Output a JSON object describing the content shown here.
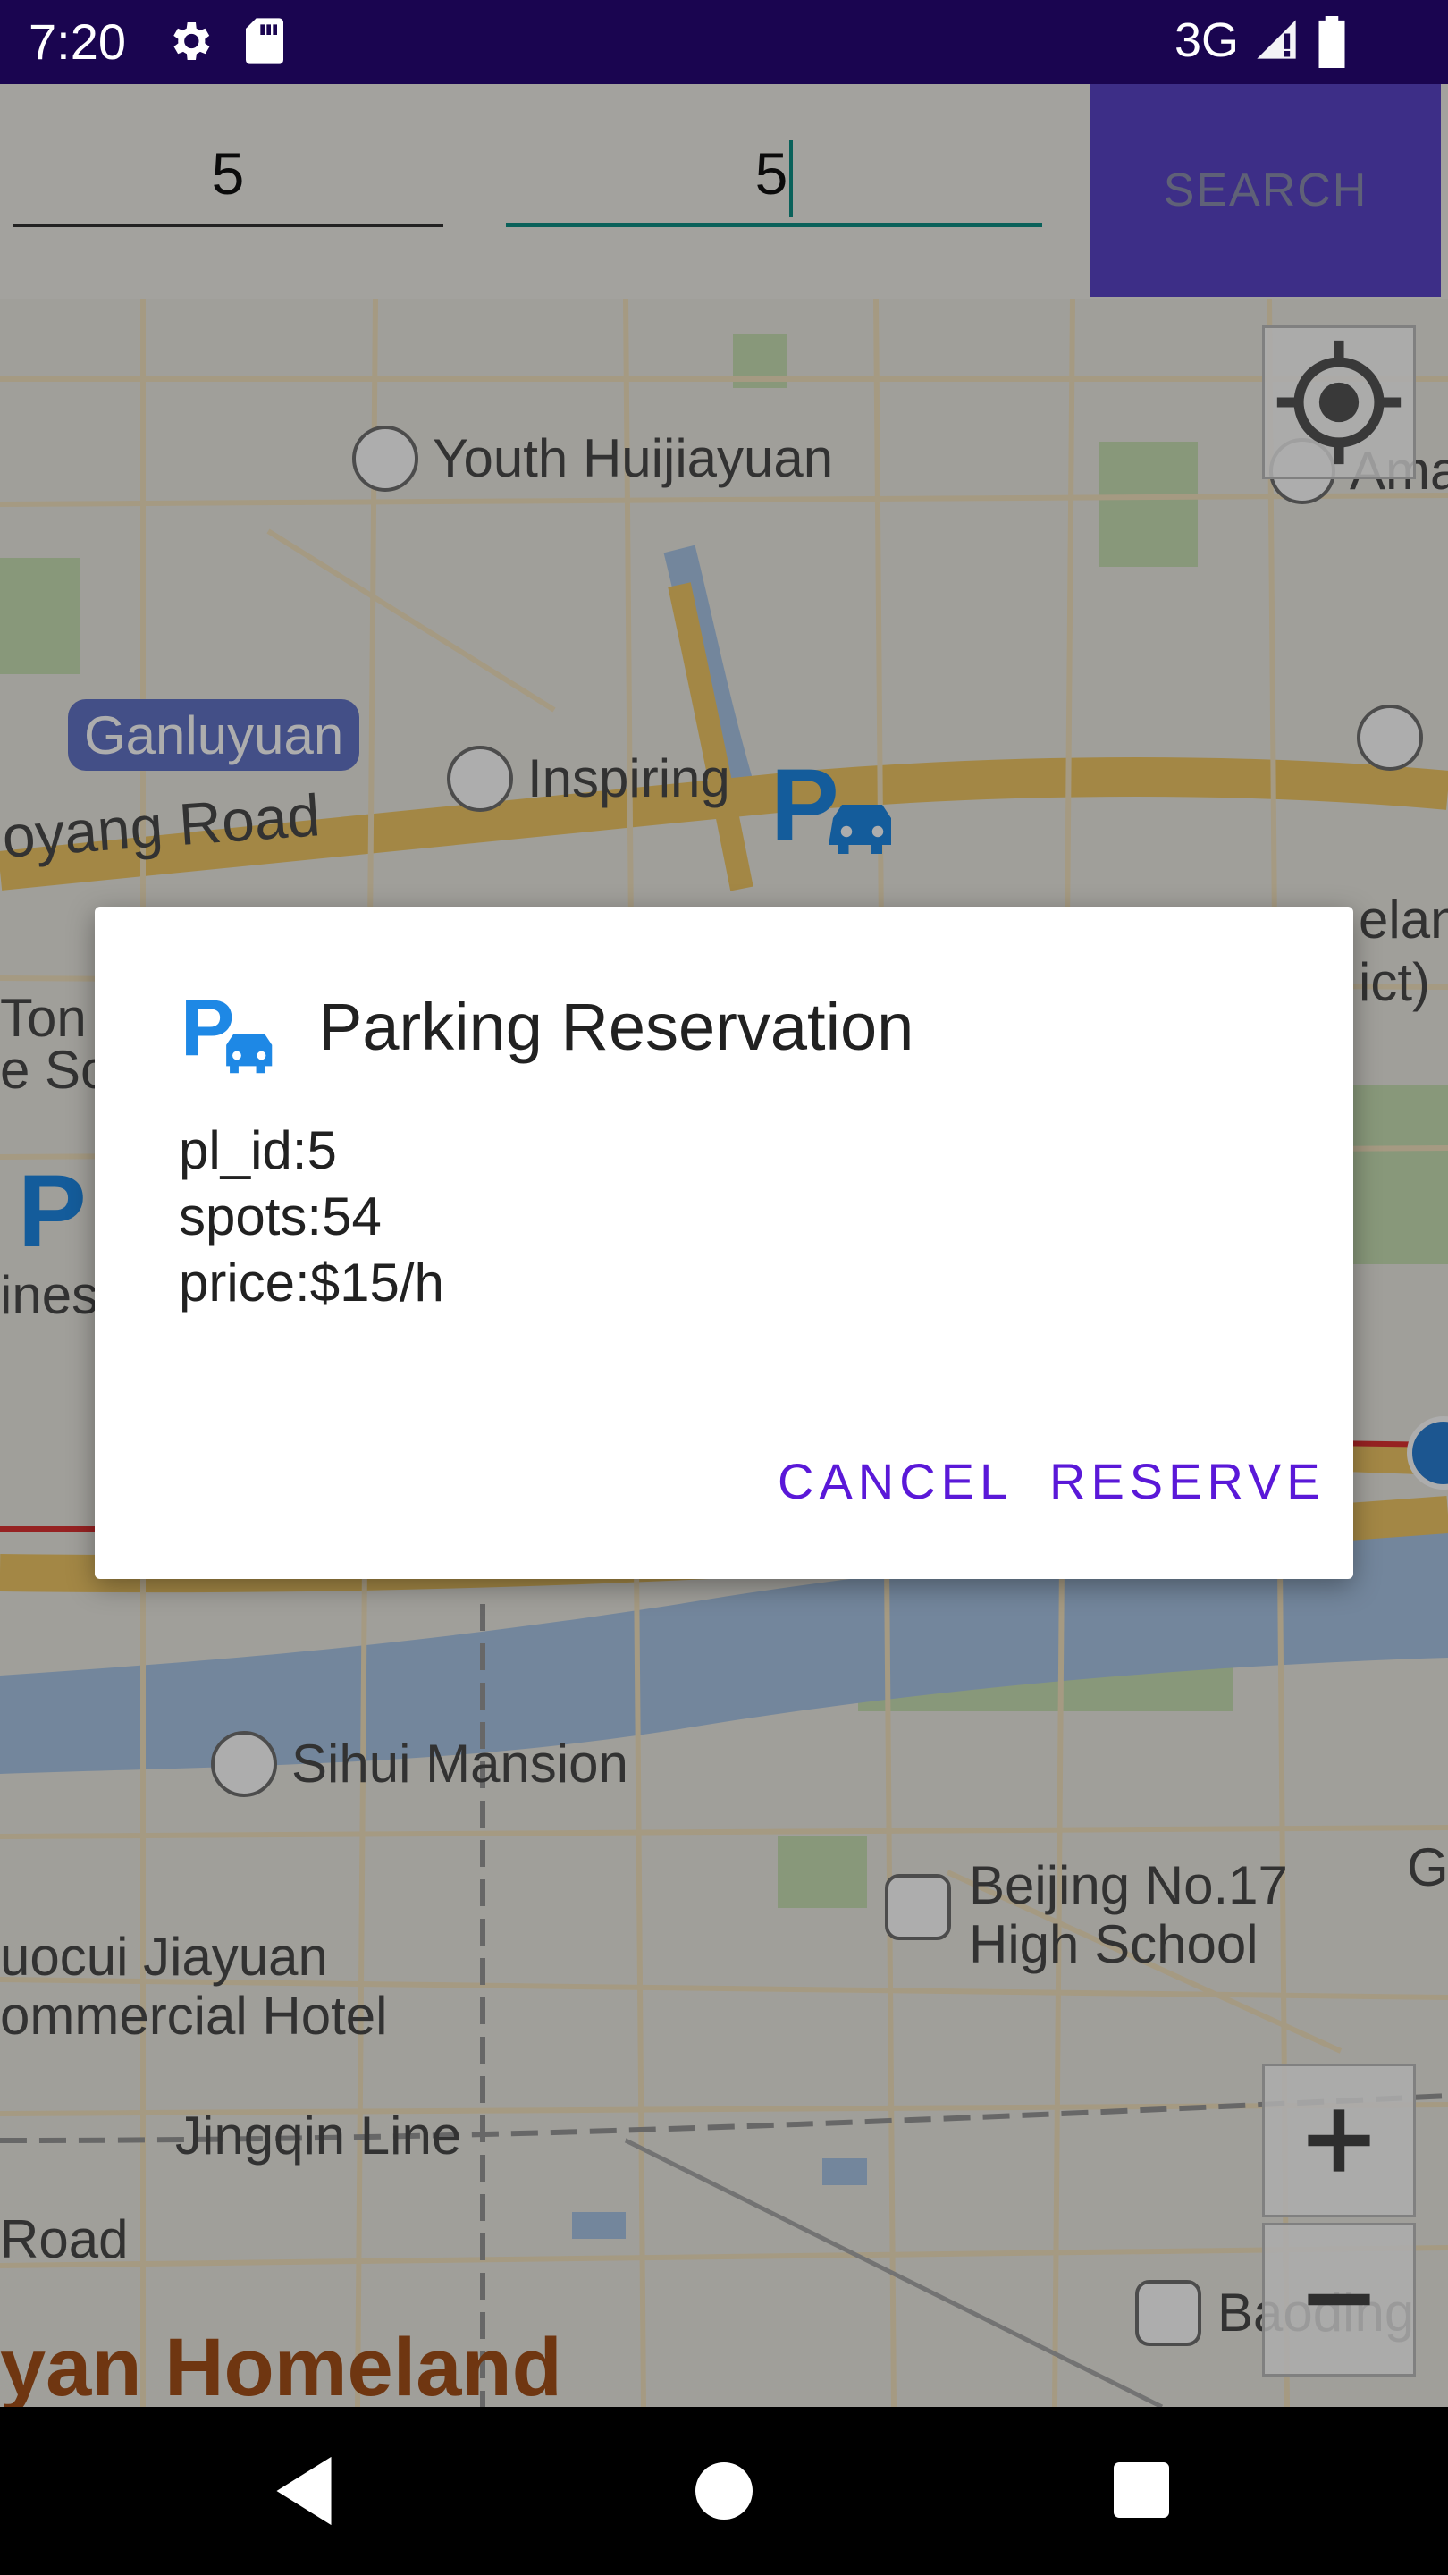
{
  "status_bar": {
    "time": "7:20",
    "network": "3G"
  },
  "search": {
    "field1_value": "5",
    "field2_value": "5",
    "button_label": "SEARCH"
  },
  "map_labels": {
    "youth": "Youth Huijiayuan",
    "ganluyuan": "Ganluyuan",
    "inspiring": "Inspiring",
    "road": "oyang Road",
    "tong": "Ton",
    "sc": "e Sc",
    "sihui": "Sihui Mansion",
    "beijing1": "Beijing No.17",
    "beijing2": "High School",
    "uocui": "uocui Jiayuan",
    "commercial": "ommercial Hotel",
    "jingqin": "Jingqin Line",
    "road2": "Road",
    "homeland": "yan Homeland",
    "baoding": "Baoding",
    "ama": "Ama",
    "elan": "elanc",
    "ict": "ict)",
    "g": "G",
    "ies": "ines"
  },
  "dialog": {
    "title": "Parking Reservation",
    "lines": [
      "pl_id:5",
      "spots:54",
      "price:$15/h"
    ],
    "cancel_label": "CANCEL",
    "reserve_label": "RESERVE"
  },
  "colors": {
    "status_bar": "#1a0550",
    "accent": "#5a18d8",
    "search_button": "#5b45c8",
    "parking_blue": "#1e88e5"
  }
}
